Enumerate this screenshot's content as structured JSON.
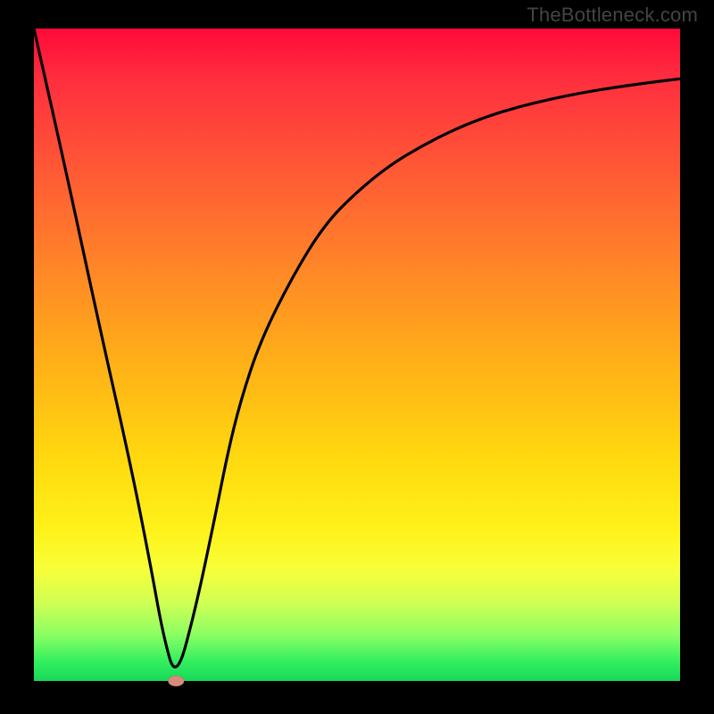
{
  "watermark": "TheBottleneck.com",
  "chart_data": {
    "type": "line",
    "title": "",
    "xlabel": "",
    "ylabel": "",
    "xlim": [
      0,
      100
    ],
    "ylim": [
      0,
      100
    ],
    "grid": false,
    "legend": false,
    "series": [
      {
        "name": "bottleneck-curve",
        "x": [
          0,
          5,
          10,
          15,
          18,
          20,
          22,
          25,
          28,
          30,
          32,
          35,
          40,
          45,
          50,
          55,
          60,
          65,
          70,
          75,
          80,
          85,
          90,
          95,
          100
        ],
        "y": [
          100,
          78,
          55,
          33,
          18,
          7,
          0,
          11,
          25,
          35,
          43,
          52,
          62,
          70,
          75,
          79,
          82,
          84.5,
          86.5,
          88,
          89.2,
          90.2,
          91,
          91.7,
          92.3
        ]
      }
    ],
    "markers": [
      {
        "name": "optimal-point",
        "x": 22,
        "y": 0,
        "color": "#d88a7d"
      }
    ],
    "background_gradient": {
      "orientation": "vertical",
      "stops": [
        {
          "value": 100,
          "color": "#ff0a3a"
        },
        {
          "value": 50,
          "color": "#ffb217"
        },
        {
          "value": 20,
          "color": "#fff21a"
        },
        {
          "value": 0,
          "color": "#17d959"
        }
      ]
    }
  }
}
